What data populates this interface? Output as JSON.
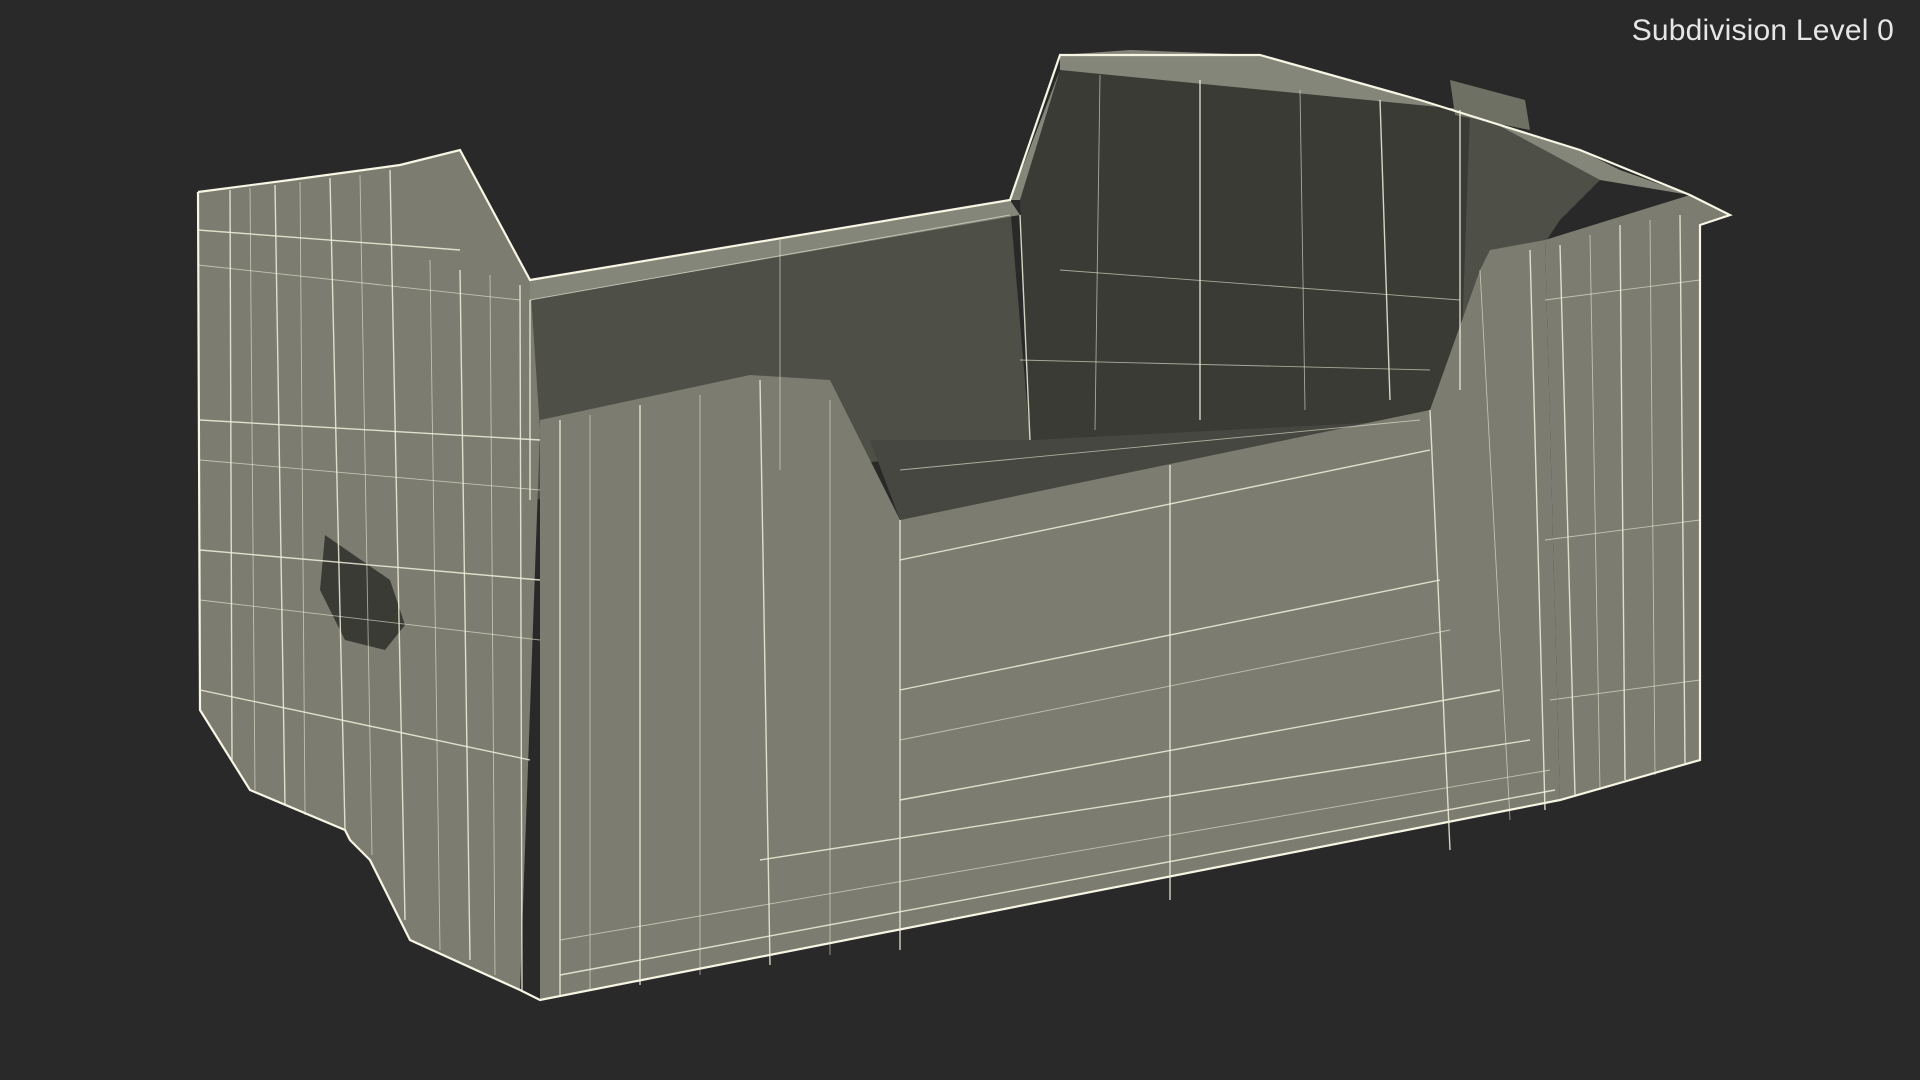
{
  "viewport": {
    "overlay_label": "Subdivision Level 0",
    "background_color": "#292929",
    "model_color": "#7c7d70",
    "wire_color": "#f2f0dc",
    "subject": "plastic crate wireframe render"
  }
}
